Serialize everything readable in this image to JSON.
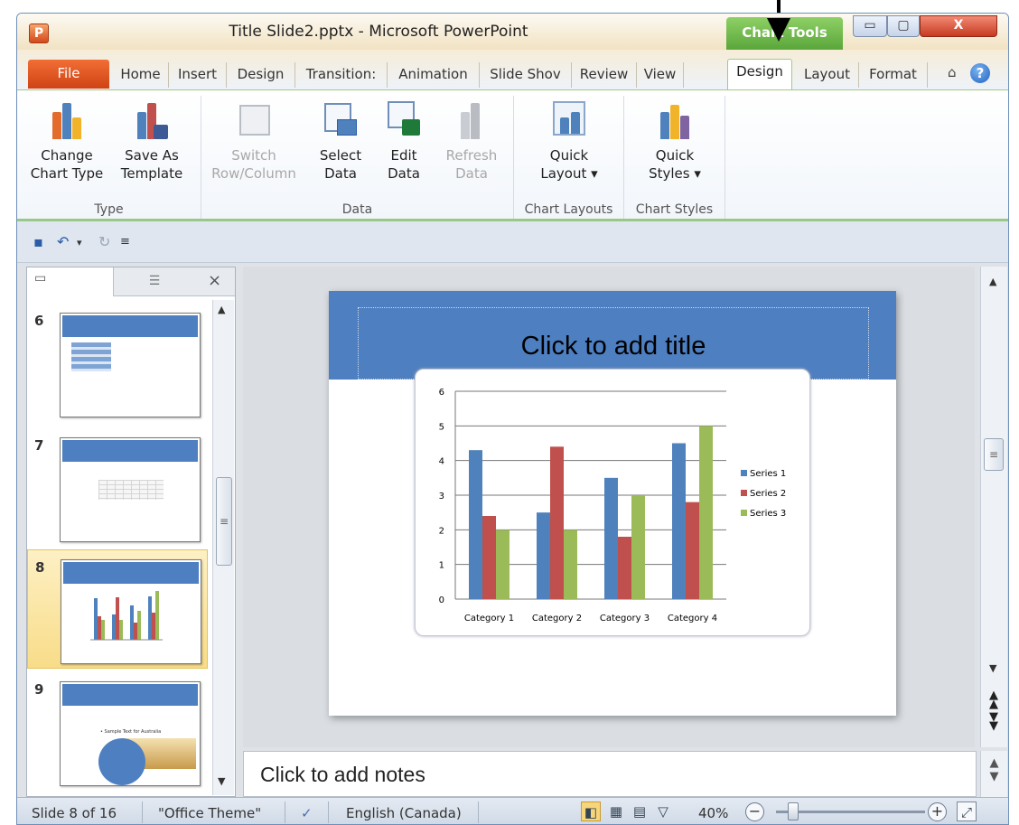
{
  "app": {
    "title": "Title Slide2.pptx  -  Microsoft PowerPoint",
    "icon_letter": "P",
    "context_tab": "Chart Tools",
    "window_buttons": {
      "minimize": "▭",
      "maximize": "▢",
      "close": "X"
    }
  },
  "tabs": {
    "file": "File",
    "items": [
      "Home",
      "Insert",
      "Design",
      "Transition:",
      "Animation",
      "Slide Shov",
      "Review",
      "View",
      "Design",
      "Layout",
      "Format"
    ],
    "selected": "Design",
    "help": "?",
    "minimize_ribbon": "⌂"
  },
  "ribbon": {
    "groups": {
      "type": "Type",
      "data": "Data",
      "chart_layouts": "Chart Layouts",
      "chart_styles": "Chart Styles"
    },
    "buttons": {
      "change_chart_type": [
        "Change",
        "Chart Type"
      ],
      "save_as_template": [
        "Save As",
        "Template"
      ],
      "switch_row_column": [
        "Switch",
        "Row/Column"
      ],
      "select_data": [
        "Select",
        "Data"
      ],
      "edit_data": [
        "Edit",
        "Data"
      ],
      "refresh_data": [
        "Refresh",
        "Data"
      ],
      "quick_layout": [
        "Quick",
        "Layout ▾"
      ],
      "quick_styles": [
        "Quick",
        "Styles ▾"
      ]
    }
  },
  "qat": {
    "customize": "⚲"
  },
  "panel": {
    "close": "×",
    "slides": [
      {
        "number": "6"
      },
      {
        "number": "7"
      },
      {
        "number": "8",
        "selected": true
      },
      {
        "number": "9",
        "caption": "• Sample Text for Australia"
      }
    ]
  },
  "slide": {
    "title_placeholder": "Click to add title",
    "header_color": "#4d7fc1"
  },
  "notes": {
    "placeholder": "Click to add notes"
  },
  "status": {
    "slide": "Slide 8 of 16",
    "theme": "\"Office Theme\"",
    "language": "English (Canada)",
    "zoom": "40%"
  },
  "chart_data": {
    "type": "bar",
    "categories": [
      "Category 1",
      "Category 2",
      "Category 3",
      "Category 4"
    ],
    "series": [
      {
        "name": "Series 1",
        "values": [
          4.3,
          2.5,
          3.5,
          4.5
        ],
        "color": "#4f81bd"
      },
      {
        "name": "Series 2",
        "values": [
          2.4,
          4.4,
          1.8,
          2.8
        ],
        "color": "#c0504d"
      },
      {
        "name": "Series 3",
        "values": [
          2,
          2,
          3,
          5
        ],
        "color": "#9bbb59"
      }
    ],
    "ylim": [
      0,
      6
    ],
    "yticks": [
      "0",
      "1",
      "2",
      "3",
      "4",
      "5",
      "6"
    ],
    "grid": true,
    "legend": "right"
  }
}
